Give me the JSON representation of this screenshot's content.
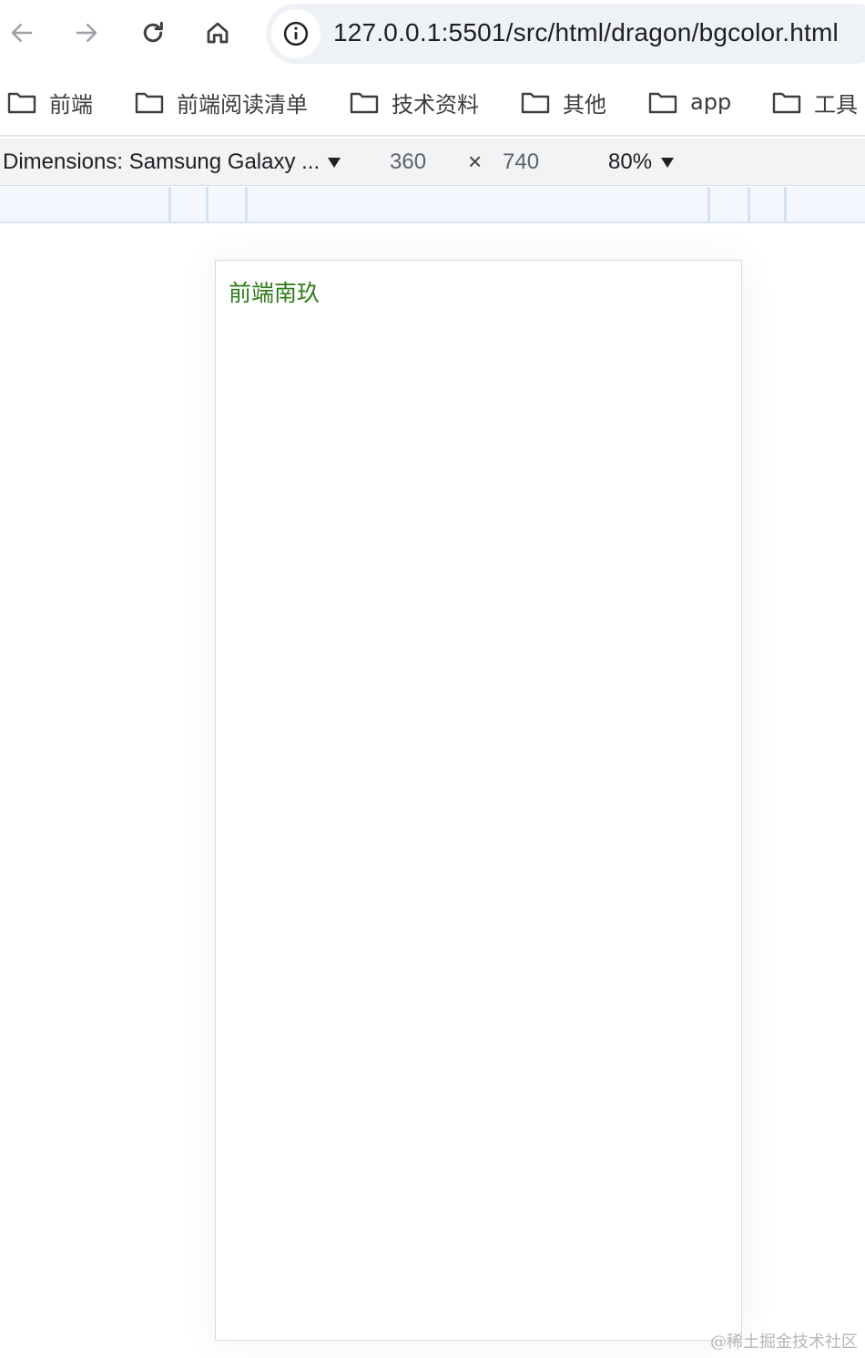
{
  "toolbar": {
    "back_icon": "arrow-left-icon",
    "forward_icon": "arrow-right-icon",
    "reload_icon": "reload-icon",
    "home_icon": "home-icon",
    "site_info_icon": "info-icon",
    "url": "127.0.0.1:5501/src/html/dragon/bgcolor.html"
  },
  "bookmarks": [
    {
      "label": "前端",
      "icon": "folder-icon"
    },
    {
      "label": "前端阅读清单",
      "icon": "folder-icon"
    },
    {
      "label": "技术资料",
      "icon": "folder-icon"
    },
    {
      "label": "其他",
      "icon": "folder-icon"
    },
    {
      "label": "app",
      "icon": "folder-icon"
    },
    {
      "label": "工具",
      "icon": "folder-icon"
    }
  ],
  "device_toolbar": {
    "dimensions_label": "Dimensions: Samsung Galaxy ...",
    "width": "360",
    "times": "×",
    "height": "740",
    "zoom": "80%"
  },
  "page": {
    "text": "前端南玖",
    "text_color": "#2e7d1a"
  },
  "watermark": "@稀土掘金技术社区",
  "colors": {
    "omnibox_bg": "#eef1f5",
    "device_bar_bg": "#f1f3f4",
    "media_bar_bg": "#f4f8fe"
  }
}
